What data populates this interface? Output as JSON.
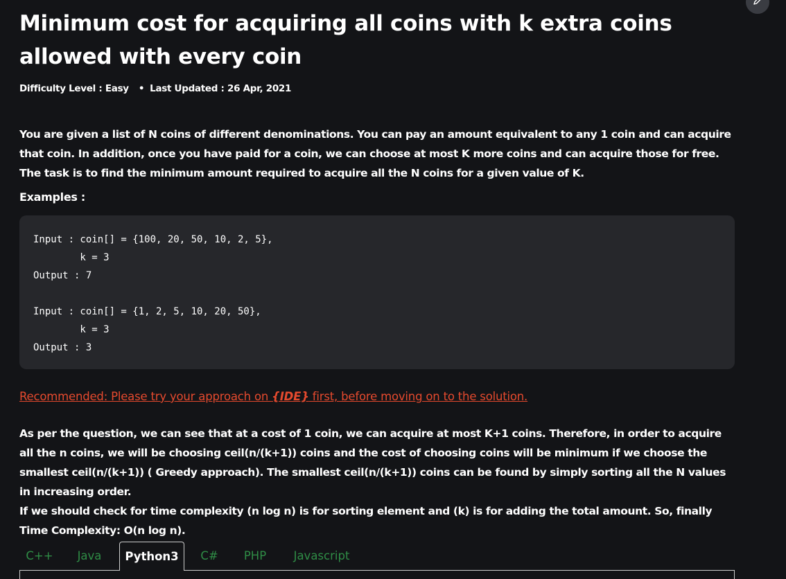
{
  "article": {
    "title": "Minimum cost for acquiring all coins with k extra coins allowed with every coin",
    "difficulty": "Difficulty Level : Easy",
    "last_updated": "Last Updated : 26 Apr, 2021",
    "meta_separator": "•",
    "intro": "You are given a list of N coins of different denominations. You can pay an amount equivalent to any 1 coin and can acquire that coin. In addition, once you have paid for a coin, we can choose at most K more coins and can acquire those for free. The task is to find the minimum amount required to acquire all the N coins for a given value of K.",
    "examples_heading": "Examples :",
    "examples_code": "Input : coin[] = {100, 20, 50, 10, 2, 5}, \n        k = 3\nOutput : 7\n\nInput : coin[] = {1, 2, 5, 10, 20, 50}, \n        k = 3\nOutput : 3",
    "recommend_prefix": "Recommended: Please try your approach on ",
    "recommend_ide": "{IDE}",
    "recommend_suffix": " first, before moving on to the solution.",
    "explanation_1": "As per the question, we can see that at a cost of 1 coin, we can acquire at most K+1 coins. Therefore, in order to acquire all the n coins, we will be choosing ceil(n/(k+1)) coins and the cost of choosing coins will be minimum if we choose the smallest ceil(n/(k+1)) ( Greedy approach). The smallest ceil(n/(k+1)) coins can be found by simply sorting all the N values in increasing order.",
    "explanation_2": "If we should check for time complexity (n log n) is for sorting element and (k) is for adding the total amount. So, finally Time Complexity: O(n log n)."
  },
  "toolbar": {
    "edit_icon": "pencil-icon"
  },
  "code_tabs": {
    "selected": "Python3",
    "items": [
      {
        "label": "C++"
      },
      {
        "label": "Java"
      },
      {
        "label": "Python3"
      },
      {
        "label": "C#"
      },
      {
        "label": "PHP"
      },
      {
        "label": "Javascript"
      }
    ]
  },
  "colors": {
    "background": "#131417",
    "code_background": "#26272b",
    "link_red": "#e64a2e",
    "tab_green": "#2f8d46"
  }
}
